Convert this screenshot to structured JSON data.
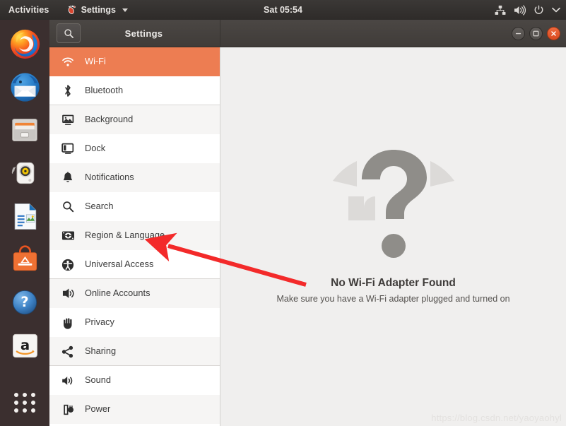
{
  "topbar": {
    "activities_label": "Activities",
    "app_menu_label": "Settings",
    "app_icon": "ubuntu-settings-icon",
    "caret_icon": "chevron-down-icon",
    "clock": "Sat 05:54",
    "indicators": [
      {
        "name": "network-icon",
        "title": "Network"
      },
      {
        "name": "volume-icon",
        "title": "Volume"
      },
      {
        "name": "power-icon",
        "title": "Power"
      },
      {
        "name": "chevron-down-icon",
        "title": "System menu"
      }
    ]
  },
  "dock": {
    "items": [
      {
        "name": "dock-item-firefox",
        "label": "Firefox"
      },
      {
        "name": "dock-item-thunderbird",
        "label": "Thunderbird Mail"
      },
      {
        "name": "dock-item-files",
        "label": "Files"
      },
      {
        "name": "dock-item-rhythmbox",
        "label": "Rhythmbox"
      },
      {
        "name": "dock-item-libreoffice-impress",
        "label": "LibreOffice Impress"
      },
      {
        "name": "dock-item-ubuntu-software",
        "label": "Ubuntu Software"
      },
      {
        "name": "dock-item-help",
        "label": "Help"
      },
      {
        "name": "dock-item-amazon",
        "label": "Amazon"
      }
    ],
    "app_grid_label": "Show Applications"
  },
  "window": {
    "title": "Settings",
    "search_icon": "search-icon",
    "controls": [
      {
        "name": "minimize-button",
        "label": "Minimize"
      },
      {
        "name": "maximize-button",
        "label": "Maximize"
      },
      {
        "name": "close-button",
        "label": "Close"
      }
    ]
  },
  "sidebar": {
    "items": [
      {
        "label": "Wi-Fi",
        "icon": "wifi-icon",
        "name": "sidebar-item-wifi",
        "selected": true,
        "separator_after": false
      },
      {
        "label": "Bluetooth",
        "icon": "bluetooth-icon",
        "name": "sidebar-item-bluetooth",
        "selected": false,
        "separator_after": true
      },
      {
        "label": "Background",
        "icon": "background-icon",
        "name": "sidebar-item-background",
        "selected": false,
        "separator_after": false
      },
      {
        "label": "Dock",
        "icon": "dock-icon",
        "name": "sidebar-item-dock",
        "selected": false,
        "separator_after": false
      },
      {
        "label": "Notifications",
        "icon": "bell-icon",
        "name": "sidebar-item-notifications",
        "selected": false,
        "separator_after": false
      },
      {
        "label": "Search",
        "icon": "search-icon",
        "name": "sidebar-item-search",
        "selected": false,
        "separator_after": false
      },
      {
        "label": "Region & Language",
        "icon": "region-language-icon",
        "name": "sidebar-item-region-language",
        "selected": false,
        "separator_after": false
      },
      {
        "label": "Universal Access",
        "icon": "accessibility-icon",
        "name": "sidebar-item-universal-access",
        "selected": false,
        "separator_after": true
      },
      {
        "label": "Online Accounts",
        "icon": "online-accounts-icon",
        "name": "sidebar-item-online-accounts",
        "selected": false,
        "separator_after": false
      },
      {
        "label": "Privacy",
        "icon": "privacy-hand-icon",
        "name": "sidebar-item-privacy",
        "selected": false,
        "separator_after": false
      },
      {
        "label": "Sharing",
        "icon": "sharing-icon",
        "name": "sidebar-item-sharing",
        "selected": false,
        "separator_after": true
      },
      {
        "label": "Sound",
        "icon": "sound-icon",
        "name": "sidebar-item-sound",
        "selected": false,
        "separator_after": false
      },
      {
        "label": "Power",
        "icon": "power-plug-icon",
        "name": "sidebar-item-power",
        "selected": false,
        "separator_after": false
      }
    ]
  },
  "main": {
    "illustration": "no-wifi-adapter-question-mark",
    "title": "No Wi-Fi Adapter Found",
    "subtitle": "Make sure you have a Wi-Fi adapter plugged and turned on",
    "watermark": "https://blog.csdn.net/yaoyaohyl"
  },
  "annotation": {
    "arrow_color": "#f32a2a",
    "points_at": "Region & Language"
  },
  "colors": {
    "accent_orange": "#ed7d52",
    "topbar": "#353230",
    "dock_bg": "#3b2f2f",
    "titlebar": "#453f3c",
    "sidebar_bg": "#ffffff",
    "sidebar_alt": "#f6f5f4",
    "main_bg": "#f0efee",
    "close_button": "#e05420"
  }
}
